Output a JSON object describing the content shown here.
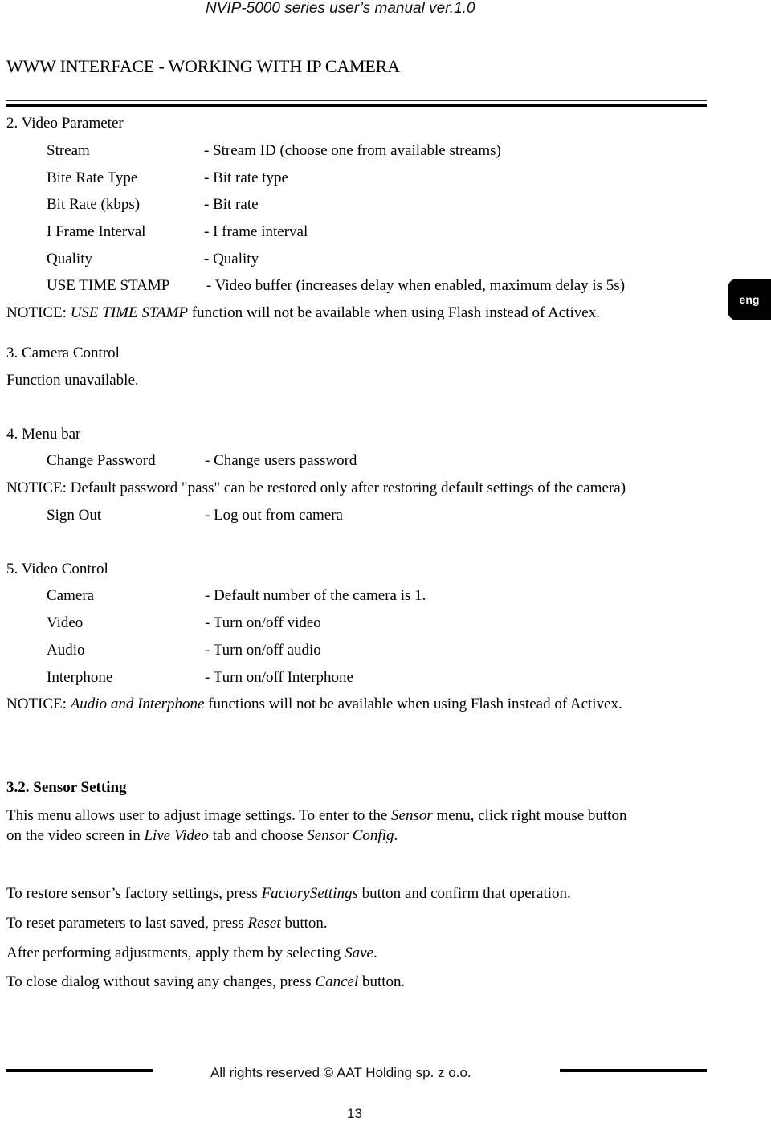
{
  "header": {
    "running_title": "NVIP-5000 series  user’s manual ver.1.0",
    "page_title": "WWW INTERFACE - WORKING WITH IP CAMERA"
  },
  "lang_tab": {
    "label": "eng"
  },
  "video_parameter": {
    "heading": "2. Video Parameter",
    "rows": [
      {
        "label": "Stream",
        "desc": "- Stream ID (choose one from available streams)"
      },
      {
        "label": "Bite Rate Type",
        "desc": "- Bit rate type"
      },
      {
        "label": "Bit Rate (kbps)",
        "desc": "- Bit rate"
      },
      {
        "label": "I Frame Interval",
        "desc": "- I frame interval"
      },
      {
        "label": "Quality",
        "desc": "- Quality"
      },
      {
        "label": "USE TIME STAMP",
        "desc": "- Video buffer (increases delay when enabled, maximum delay is 5s)"
      }
    ],
    "notice": {
      "prefix": "NOTICE: ",
      "emphasis": "USE TIME STAMP",
      "suffix": " function will not be available when using Flash instead of Activex."
    }
  },
  "camera_control": {
    "heading": "3. Camera Control",
    "text": "Function unavailable."
  },
  "menu_bar": {
    "heading": "4. Menu bar",
    "rows": [
      {
        "label": "Change Password",
        "desc": "- Change users password"
      },
      {
        "label": "Sign Out",
        "desc": "- Log out from camera"
      }
    ],
    "notice": "NOTICE: Default password \"pass\" can be restored only after restoring default settings of the camera)"
  },
  "video_control": {
    "heading": "5. Video Control",
    "rows": [
      {
        "label": "Camera",
        "desc": "- Default number of the camera is 1."
      },
      {
        "label": "Video",
        "desc": "- Turn on/off video"
      },
      {
        "label": "Audio",
        "desc": "- Turn on/off audio"
      },
      {
        "label": "Interphone",
        "desc": "- Turn on/off Interphone"
      }
    ],
    "notice": {
      "prefix": "NOTICE: ",
      "emphasis": "Audio and Interphone",
      "suffix": " functions will not be available when using Flash instead of Activex."
    }
  },
  "sensor_setting": {
    "heading": "3.2. Sensor Setting",
    "intro_line1": {
      "a": "This menu allows user to adjust image settings. To enter to the ",
      "em1": "Sensor",
      "b": " menu, click right mouse button"
    },
    "intro_line2": {
      "a": "on the video screen in ",
      "em1": "Live Video",
      "b": " tab and choose ",
      "em2": "Sensor Config",
      "c": "."
    },
    "instructions": [
      {
        "a": "To restore sensor’s factory settings, press ",
        "em": "FactorySettings",
        "b": " button and confirm that operation."
      },
      {
        "a": "To reset parameters to last saved, press ",
        "em": "Reset",
        "b": " button."
      },
      {
        "a": "After performing adjustments, apply them by selecting ",
        "em": "Save",
        "b": "."
      },
      {
        "a": "To close dialog without saving any changes, press ",
        "em": "Cancel",
        "b": " button."
      }
    ]
  },
  "footer": {
    "copyright": "All rights reserved © AAT Holding sp. z o.o.",
    "page_number": "13"
  }
}
